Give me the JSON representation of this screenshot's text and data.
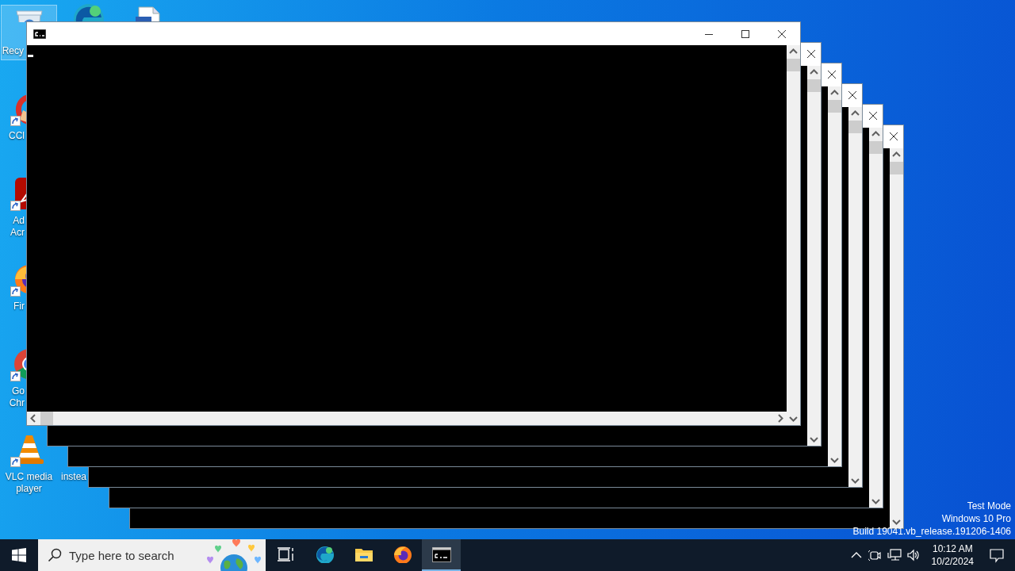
{
  "desktop": {
    "icons": [
      {
        "kind": "recycle-bin",
        "label_lines": [
          "Recy"
        ],
        "cut": true,
        "shortcut": false,
        "selected": true
      },
      {
        "kind": "edge",
        "shortcut": false,
        "selected": false
      },
      {
        "kind": "document",
        "shortcut": false,
        "selected": false
      },
      {
        "kind": "ccleaner",
        "label_lines": [
          "CCl"
        ],
        "cut": true,
        "shortcut": true,
        "selected": false
      },
      {
        "kind": "acrobat",
        "label_lines": [
          "Ad",
          "Acr"
        ],
        "cut": true,
        "shortcut": true,
        "selected": false
      },
      {
        "kind": "firefox",
        "label_lines": [
          "Fir"
        ],
        "cut": true,
        "shortcut": true,
        "selected": false
      },
      {
        "kind": "chrome",
        "label_lines": [
          "Go",
          "Chr"
        ],
        "cut": true,
        "shortcut": true,
        "selected": false
      },
      {
        "kind": "vlc",
        "label_lines": [
          "VLC media",
          "player"
        ],
        "cut": false,
        "shortcut": true,
        "selected": false
      },
      {
        "label_lines": [
          "instea"
        ],
        "cut": true,
        "shortcut": false,
        "selected": false
      }
    ],
    "system_watermark": [
      "Test Mode",
      "Windows 10 Pro",
      "Build 19041.vb_release.191206-1406"
    ]
  },
  "windows": [
    {
      "title_icon": true,
      "buttons": [
        {
          "kind": "minimize"
        },
        {
          "kind": "maximize"
        },
        {
          "kind": "close"
        }
      ],
      "horizontal_scrollbar": true,
      "cursor": true
    },
    {
      "buttons": [
        {
          "kind": "close"
        }
      ],
      "horizontal_scrollbar": false
    },
    {
      "buttons": [
        {
          "kind": "close"
        }
      ],
      "horizontal_scrollbar": false
    },
    {
      "buttons": [
        {
          "kind": "close"
        }
      ],
      "horizontal_scrollbar": false
    },
    {
      "buttons": [
        {
          "kind": "close"
        }
      ],
      "horizontal_scrollbar": false
    },
    {
      "buttons": [
        {
          "kind": "close"
        }
      ],
      "horizontal_scrollbar": false
    }
  ],
  "taskbar": {
    "search": {
      "placeholder": "Type here to search"
    },
    "apps": [
      {
        "kind": "task-view",
        "selected": false
      },
      {
        "kind": "edge",
        "selected": false
      },
      {
        "kind": "explorer",
        "selected": false
      },
      {
        "kind": "firefox",
        "selected": false
      },
      {
        "kind": "terminal",
        "selected": true
      }
    ],
    "tray": {
      "icons": [
        {
          "kind": "chevron"
        },
        {
          "kind": "camera"
        },
        {
          "kind": "network"
        },
        {
          "kind": "volume"
        }
      ],
      "time": "10:12 AM",
      "date": "10/2/2024"
    },
    "notification": true
  }
}
